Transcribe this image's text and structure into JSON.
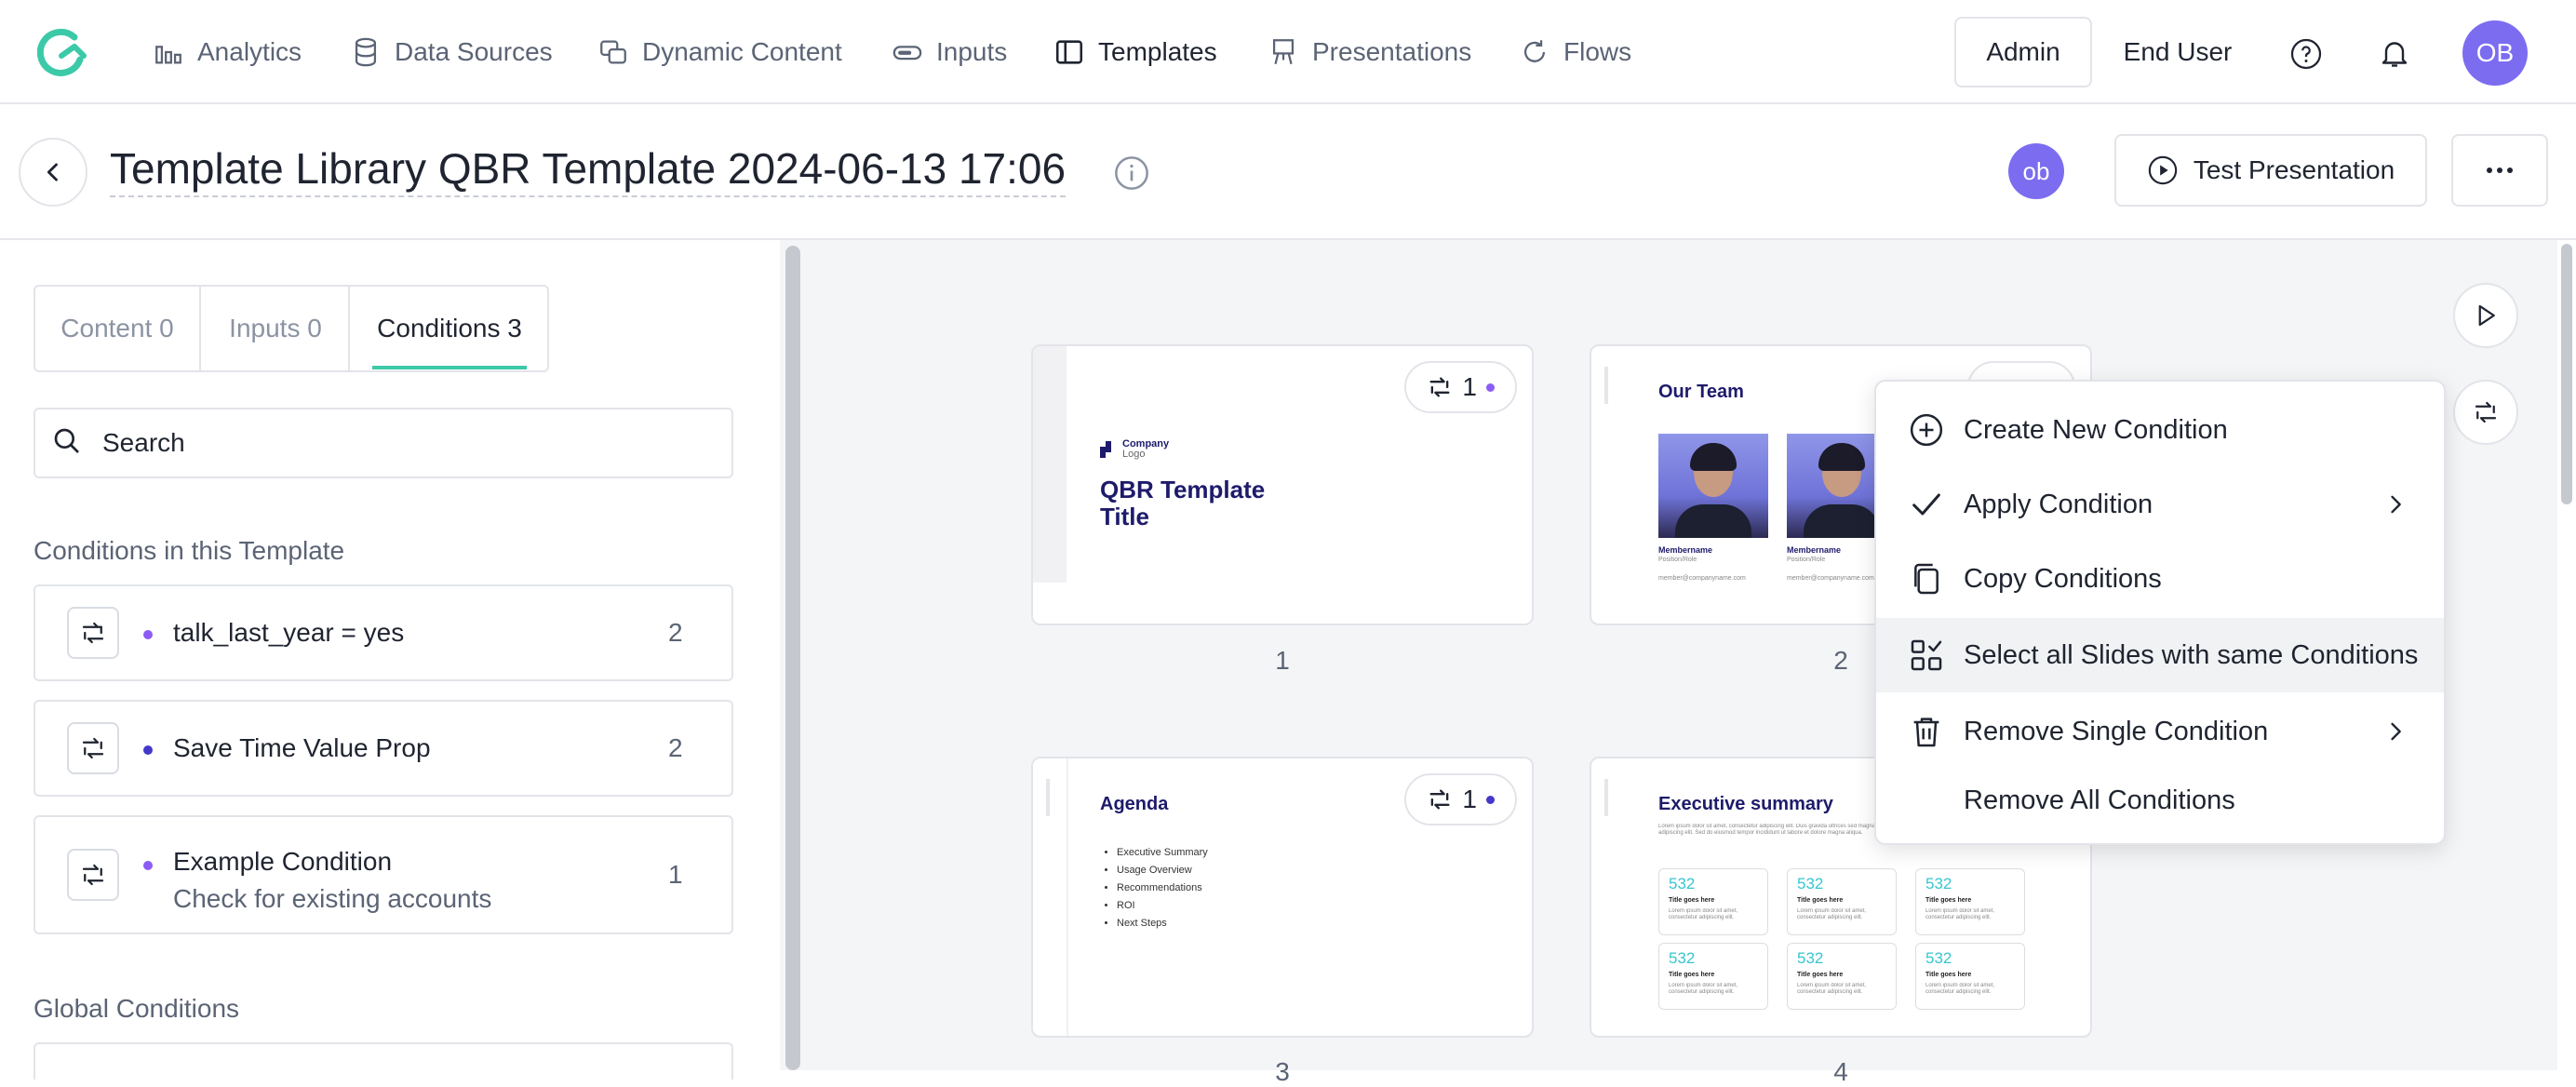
{
  "nav": {
    "items": [
      {
        "label": "Analytics",
        "icon": "bar-chart-icon"
      },
      {
        "label": "Data Sources",
        "icon": "database-icon"
      },
      {
        "label": "Dynamic Content",
        "icon": "layers-icon"
      },
      {
        "label": "Inputs",
        "icon": "toggle-icon"
      },
      {
        "label": "Templates",
        "icon": "template-icon"
      },
      {
        "label": "Presentations",
        "icon": "easel-icon"
      },
      {
        "label": "Flows",
        "icon": "refresh-icon"
      }
    ],
    "admin_label": "Admin",
    "end_user_label": "End User",
    "user_initials": "OB",
    "help_icon": "help-circle-icon",
    "bell_icon": "bell-icon"
  },
  "header": {
    "title": "Template Library QBR Template 2024-06-13 17:06",
    "collaborator_initials": "ob",
    "test_button_label": "Test Presentation",
    "more_icon": "ellipsis-icon"
  },
  "sidebar": {
    "tabs": [
      {
        "label": "Content 0"
      },
      {
        "label": "Inputs 0"
      },
      {
        "label": "Conditions 3"
      }
    ],
    "search_placeholder": "Search",
    "template_section_title": "Conditions in this Template",
    "conditions": [
      {
        "name": "talk_last_year = yes",
        "description": "",
        "count": "2",
        "dot_color": "#8b5cf6"
      },
      {
        "name": "Save Time Value Prop",
        "description": "",
        "count": "2",
        "dot_color": "#4338ca"
      },
      {
        "name": "Example Condition",
        "description": "Check for existing accounts",
        "count": "1",
        "dot_color": "#8b5cf6"
      }
    ],
    "global_section_title": "Global Conditions"
  },
  "slides": [
    {
      "number": "1",
      "badge_count": "1",
      "logo_line1": "Company",
      "logo_line2": "Logo",
      "title": "QBR Template Title"
    },
    {
      "number": "2",
      "title": "Our Team",
      "members": [
        {
          "name": "Membername",
          "role": "Position/Role",
          "email": "member@companyname.com"
        },
        {
          "name": "Membername",
          "role": "Position/Role",
          "email": "member@companyname.com"
        }
      ]
    },
    {
      "number": "3",
      "badge_count": "1",
      "title": "Agenda",
      "bullets": [
        "Executive Summary",
        "Usage Overview",
        "Recommendations",
        "ROI",
        "Next Steps"
      ]
    },
    {
      "number": "4",
      "title": "Executive summary",
      "intro": "Lorem ipsum dolor sit amet, consectetur adipiscing elit. Duis gravida ultrices sed magna eu. Nulla facilisi lorem ipsum dolor sit amet, consectetur adipiscing elit. Sed do eiusmod tempor incididunt ut labore et dolore magna aliqua.",
      "stats": [
        {
          "value": "532",
          "label": "Title goes here",
          "text": "Lorem ipsum dolor sit amet, consectetur adipiscing elit."
        },
        {
          "value": "532",
          "label": "Title goes here",
          "text": "Lorem ipsum dolor sit amet, consectetur adipiscing elit."
        },
        {
          "value": "532",
          "label": "Title goes here",
          "text": "Lorem ipsum dolor sit amet, consectetur adipiscing elit."
        },
        {
          "value": "532",
          "label": "Title goes here",
          "text": "Lorem ipsum dolor sit amet, consectetur adipiscing elit."
        },
        {
          "value": "532",
          "label": "Title goes here",
          "text": "Lorem ipsum dolor sit amet, consectetur adipiscing elit."
        },
        {
          "value": "532",
          "label": "Title goes here",
          "text": "Lorem ipsum dolor sit amet, consectetur adipiscing elit."
        }
      ]
    }
  ],
  "context_menu": {
    "items": [
      {
        "label": "Create New Condition",
        "icon": "plus-circle-icon",
        "submenu": false
      },
      {
        "label": "Apply Condition",
        "icon": "check-icon",
        "submenu": true
      },
      {
        "label": "Copy Conditions",
        "icon": "copy-icon",
        "submenu": false
      },
      {
        "label": "Select all Slides with same Conditions",
        "icon": "select-grid-icon",
        "submenu": false
      },
      {
        "label": "Remove Single Condition",
        "icon": "trash-icon",
        "submenu": true
      },
      {
        "label": "Remove All Conditions",
        "icon": "",
        "submenu": false
      }
    ]
  },
  "colors": {
    "accent": "#7c6cf0",
    "tab_underline": "#3cc9a8",
    "slide_title": "#1e1b6b",
    "stat_value": "#37c6d0"
  }
}
